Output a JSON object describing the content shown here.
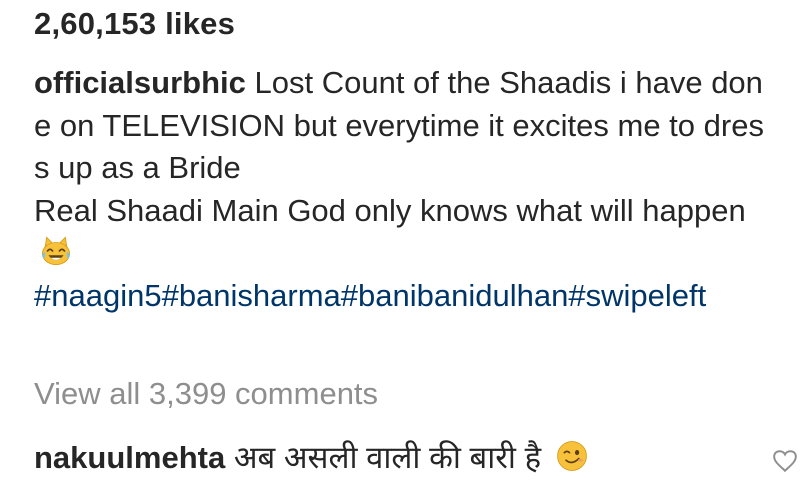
{
  "post": {
    "likes": "2,60,153 likes",
    "caption": {
      "username": "officialsurbhic",
      "lines": [
        "Lost Count of the Shaadis i have done on TELEVISION but everytime it excites me to dress up as a Bride",
        "Real Shaadi Main God only knows what will happen"
      ],
      "emoji": "joy-cat-emoji",
      "hashtags": "#naagin5#banisharma#banibanidulhan#swipeleft"
    },
    "view_all_comments": "View all 3,399 comments",
    "comments": [
      {
        "username": "nakuulmehta",
        "text": "अब असली वाली की बारी है",
        "emoji": "winking-face-emoji"
      }
    ]
  },
  "colors": {
    "text": "#262626",
    "hashtag": "#003569",
    "muted": "#8e8e8e",
    "emoji_yellow": "#f7c23a"
  }
}
